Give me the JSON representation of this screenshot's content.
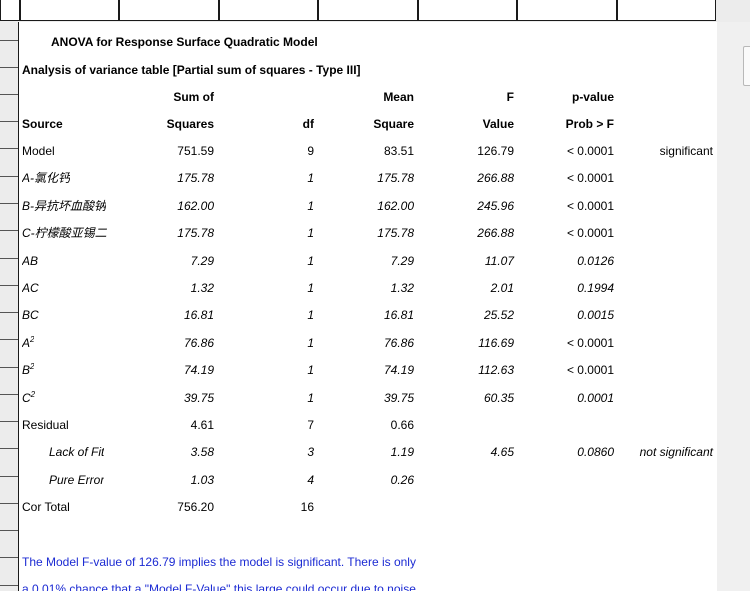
{
  "report": {
    "title": "ANOVA for Response Surface Quadratic Model",
    "subtitle": "Analysis of variance table [Partial sum of squares - Type III]"
  },
  "table": {
    "header_row1": [
      "",
      "Sum of",
      "",
      "Mean",
      "F",
      "p-value",
      ""
    ],
    "header_row2": [
      "Source",
      "Squares",
      "df",
      "Square",
      "Value",
      "Prob > F",
      ""
    ],
    "rows": [
      {
        "source": "Model",
        "ss": "751.59",
        "df": "9",
        "ms": "83.51",
        "f": "126.79",
        "p": "< 0.0001",
        "note": "significant",
        "style": "normal"
      },
      {
        "source": "A-氯化钙",
        "ss": "175.78",
        "df": "1",
        "ms": "175.78",
        "f": "266.88",
        "p": "< 0.0001",
        "note": "",
        "style": "italic"
      },
      {
        "source": "B-异抗坏血酸钠",
        "ss": "162.00",
        "df": "1",
        "ms": "162.00",
        "f": "245.96",
        "p": "< 0.0001",
        "note": "",
        "style": "italic"
      },
      {
        "source": "C-柠檬酸亚锡二",
        "ss": "175.78",
        "df": "1",
        "ms": "175.78",
        "f": "266.88",
        "p": "< 0.0001",
        "note": "",
        "style": "italic"
      },
      {
        "source": "AB",
        "ss": "7.29",
        "df": "1",
        "ms": "7.29",
        "f": "11.07",
        "p": "0.0126",
        "note": "",
        "style": "italic"
      },
      {
        "source": "AC",
        "ss": "1.32",
        "df": "1",
        "ms": "1.32",
        "f": "2.01",
        "p": "0.1994",
        "note": "",
        "style": "italic"
      },
      {
        "source": "BC",
        "ss": "16.81",
        "df": "1",
        "ms": "16.81",
        "f": "25.52",
        "p": "0.0015",
        "note": "",
        "style": "italic"
      },
      {
        "source": "A",
        "sup": "2",
        "ss": "76.86",
        "df": "1",
        "ms": "76.86",
        "f": "116.69",
        "p": "< 0.0001",
        "note": "",
        "style": "italic"
      },
      {
        "source": "B",
        "sup": "2",
        "ss": "74.19",
        "df": "1",
        "ms": "74.19",
        "f": "112.63",
        "p": "< 0.0001",
        "note": "",
        "style": "italic"
      },
      {
        "source": "C",
        "sup": "2",
        "ss": "39.75",
        "df": "1",
        "ms": "39.75",
        "f": "60.35",
        "p": "0.0001",
        "note": "",
        "style": "italic"
      },
      {
        "source": "Residual",
        "ss": "4.61",
        "df": "7",
        "ms": "0.66",
        "f": "",
        "p": "",
        "note": "",
        "style": "normal"
      },
      {
        "source": "Lack of Fit",
        "ss": "3.58",
        "df": "3",
        "ms": "1.19",
        "f": "4.65",
        "p": "0.0860",
        "note": "not significant",
        "style": "italic-indent"
      },
      {
        "source": "Pure Error",
        "ss": "1.03",
        "df": "4",
        "ms": "0.26",
        "f": "",
        "p": "",
        "note": "",
        "style": "italic-indent"
      },
      {
        "source": "Cor Total",
        "ss": "756.20",
        "df": "16",
        "ms": "",
        "f": "",
        "p": "",
        "note": "",
        "style": "normal"
      }
    ]
  },
  "footer": {
    "line1": "The Model F-value of 126.79 implies the model is significant.  There is only",
    "line2": "a 0.01% chance that a \"Model F-Value\" this large could occur due to noise."
  }
}
